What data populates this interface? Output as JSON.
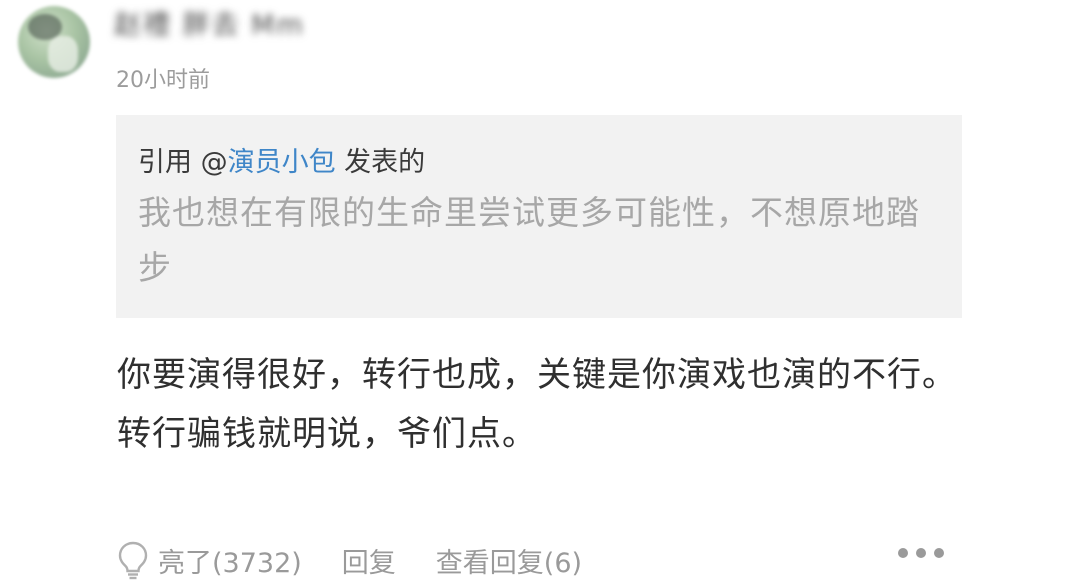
{
  "comment": {
    "username": "赵禮 胖去 Mm",
    "timestamp": "20小时前",
    "quote": {
      "prefix": "引用 @",
      "mention": "演员小包",
      "suffix": " 发表的",
      "text": "我也想在有限的生命里尝试更多可能性，不想原地踏步"
    },
    "body": {
      "line1": "你要演得很好，转行也成，关键是你演戏也演的不行。",
      "line2": "转行骗钱就明说，爷们点。"
    },
    "actions": {
      "like_icon": "lightbulb-icon",
      "like_label": "亮了(3732)",
      "reply_label": "回复",
      "view_replies_label": "查看回复(6)",
      "more_icon": "more-dots-icon"
    }
  }
}
